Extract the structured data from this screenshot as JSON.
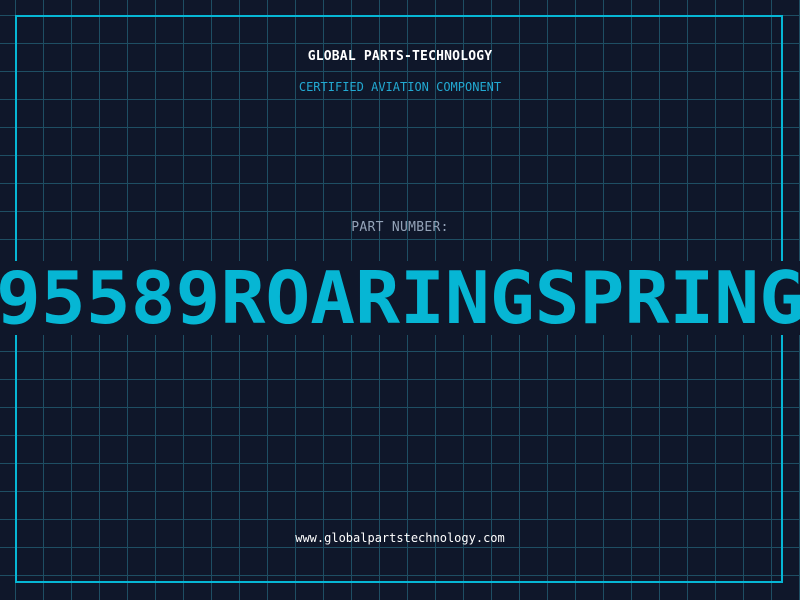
{
  "header": {
    "company": "GLOBAL PARTS-TECHNOLOGY",
    "subtitle": "CERTIFIED AVIATION COMPONENT"
  },
  "part": {
    "label": "PART NUMBER:",
    "number": "95589ROARINGSPRING"
  },
  "footer": {
    "website": "www.globalpartstechnology.com"
  },
  "colors": {
    "background": "#0f172a",
    "grid": "#1e4e63",
    "frame": "#06b6d4",
    "accent": "#06b6d4",
    "muted": "#94a3b8"
  }
}
